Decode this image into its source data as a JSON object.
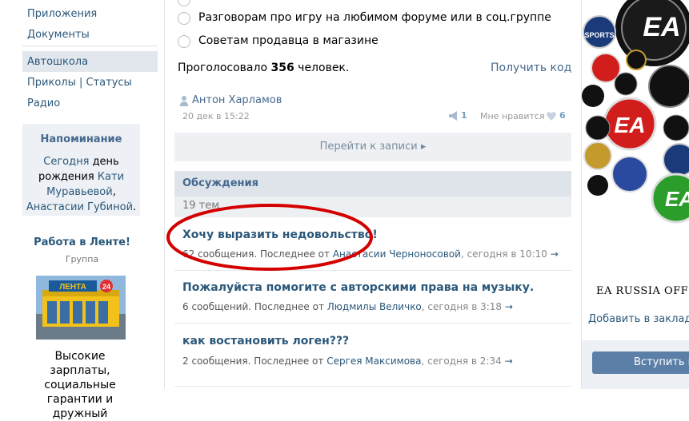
{
  "sidebar": {
    "nav_items": [
      "Приложения",
      "Документы",
      "Автошкола",
      "Приколы | Статусы",
      "Радио"
    ],
    "reminder": {
      "title": "Напоминание",
      "line1_link": "Сегодня",
      "line1_text": " день",
      "line2_text": "рождения ",
      "line2_link": "Кати",
      "line3_link": "Муравьевой",
      "line3_text": ",",
      "line4_link": "Анастасии Губиной",
      "line4_text": "."
    },
    "group": {
      "title": "Работа в Ленте!",
      "subtitle": "Группа",
      "image_logo": "ЛЕНТА",
      "image_badge": "24",
      "text_line1": "Высокие зарплаты,",
      "text_line2": "социальные",
      "text_line3": "гарантии и дружный"
    }
  },
  "poll": {
    "options": [
      "Разговорам про игру на любимом форуме или в соц.группе",
      "Советам продавца в магазине"
    ],
    "voted_prefix": "Проголосовало ",
    "voted_count": "356",
    "voted_suffix": " человек.",
    "get_code": "Получить код"
  },
  "post": {
    "author": "Антон Харламов",
    "date": "20 дек в 15:22",
    "share_count": "1",
    "like_label": "Мне нравится",
    "like_count": "6",
    "goto_label": "Перейти к записи",
    "goto_arrow": "▸"
  },
  "discussions": {
    "title": "Обсуждения",
    "count": "19 тем",
    "topics": [
      {
        "title": "Хочу выразить недовольство!",
        "count": "62 сообщения. Последнее от ",
        "who": "Анастасии Черноносовой",
        "when": ", сегодня в 10:10",
        "arrow": "→"
      },
      {
        "title": "Пожалуйста помогите с авторскими права на музыку.",
        "count": "6 сообщений. Последнее от ",
        "who": "Людмилы Величко",
        "when": ", сегодня в 3:18",
        "arrow": "→"
      },
      {
        "title": "как востановить логен???",
        "count": "2 сообщения. Последнее от ",
        "who": "Сергея Максимова",
        "when": ", сегодня в 2:34",
        "arrow": "→"
      }
    ],
    "highlight_color": "#d40000"
  },
  "right": {
    "logo_text": "EA",
    "logo_sports": "SPORTS",
    "group_name": "EA RUSSIA OFFICIAL",
    "bookmark": "Добавить в закладки",
    "join_button": "Вступить в группу"
  },
  "icons": [
    "person-icon",
    "megaphone-icon",
    "heart-icon"
  ],
  "colors": {
    "link": "#2b587a",
    "header_bg": "#dee4ea",
    "button": "#5b7fa6"
  }
}
